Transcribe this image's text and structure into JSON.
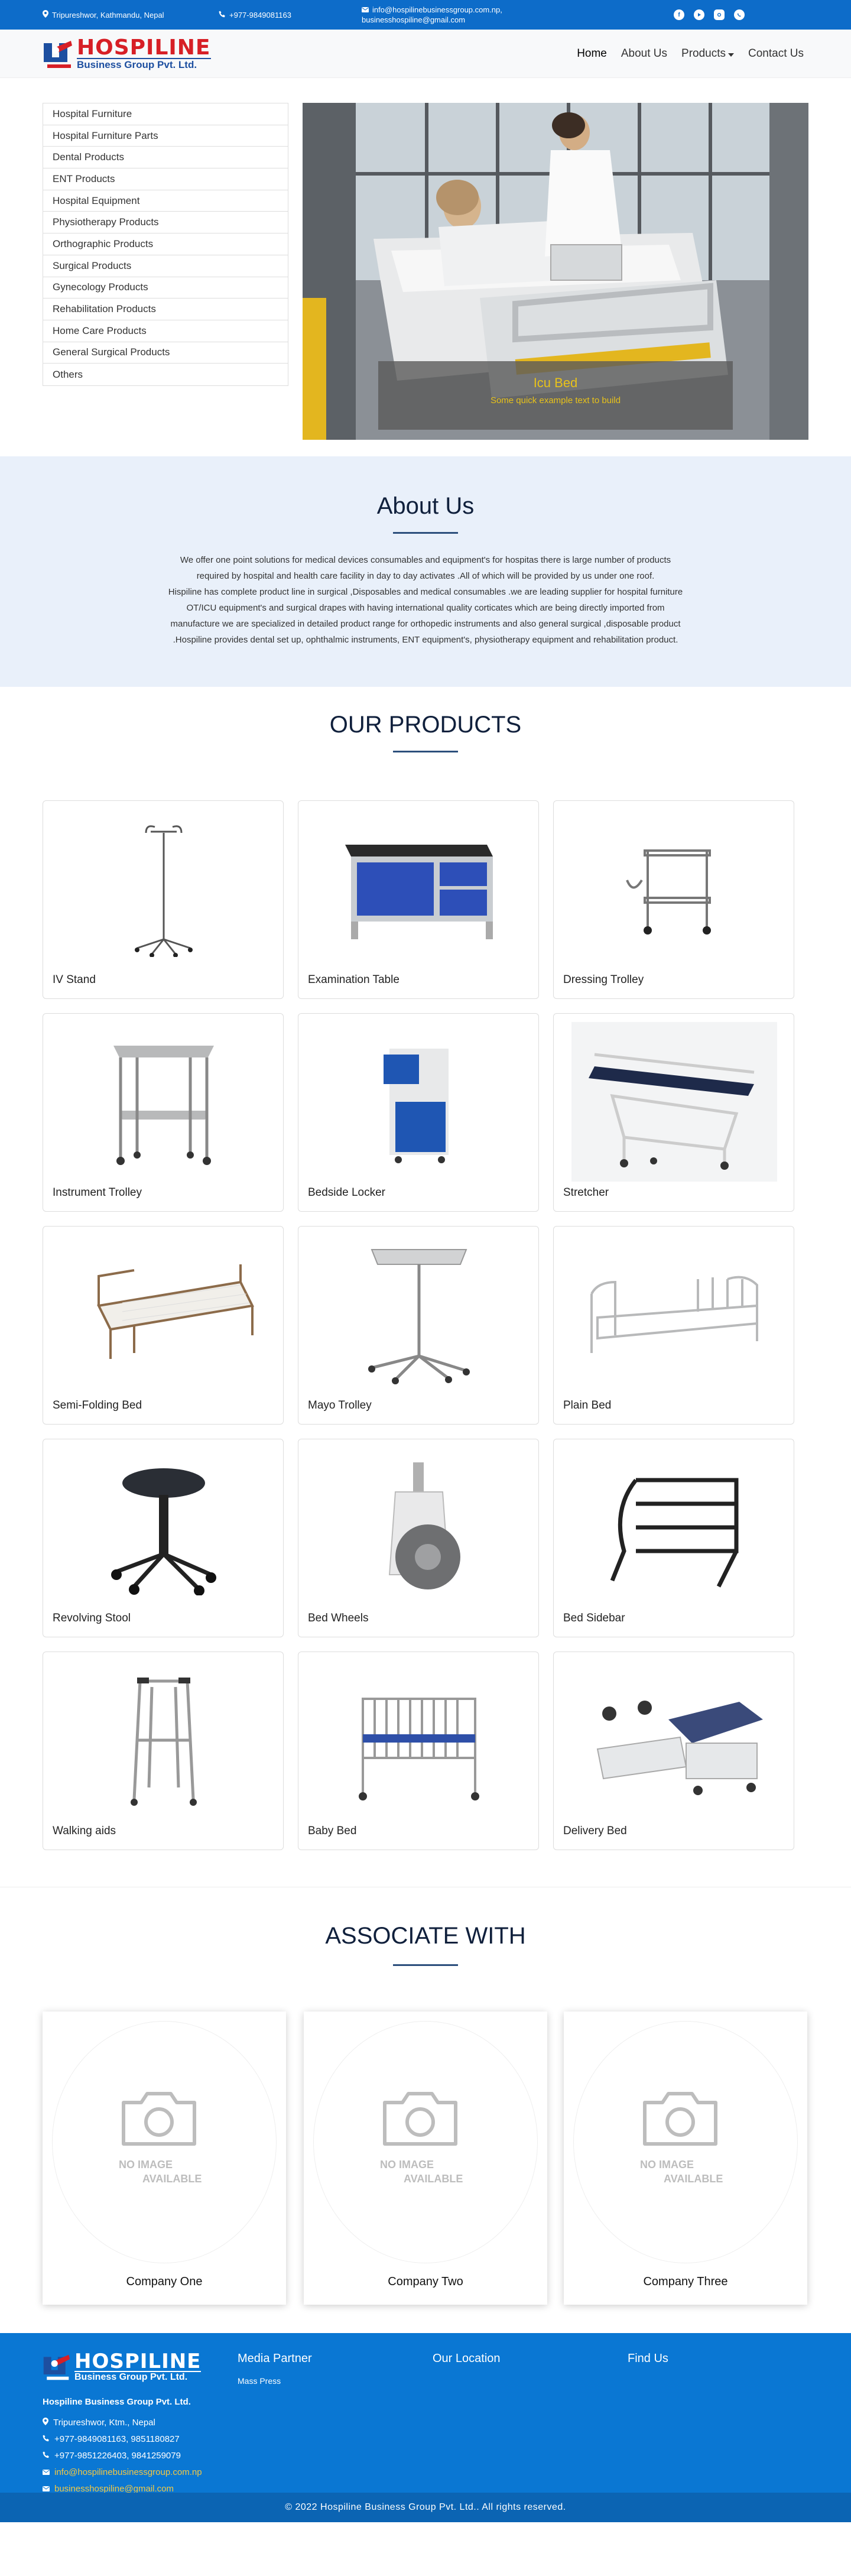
{
  "topbar": {
    "address": "Tripureshwor, Kathmandu, Nepal",
    "phone": "+977-9849081163",
    "email1": "info@hospilinebusinessgroup.com.np,",
    "email2": "businesshospiline@gmail.com"
  },
  "brand": {
    "name": "HOSPILINE",
    "sub": "Business Group Pvt. Ltd.",
    "color_red": "#d71f26",
    "color_blue": "#1d4fa0"
  },
  "nav": {
    "home": "Home",
    "about": "About Us",
    "products": "Products",
    "contact": "Contact Us"
  },
  "sidebar": {
    "items": [
      "Hospital Furniture",
      "Hospital Furniture Parts",
      "Dental Products",
      "ENT Products",
      "Hospital Equipment",
      "Physiotherapy Products",
      "Orthographic Products",
      "Surgical Products",
      "Gynecology Products",
      "Rehabilitation Products",
      "Home Care Products",
      "General Surgical Products",
      "Others"
    ]
  },
  "carousel": {
    "caption_title": "Icu Bed",
    "caption_text": "Some quick example text to build"
  },
  "about": {
    "title": "About Us",
    "lines": [
      "We offer one point solutions for medical devices consumables and equipment's for hospitas there is large number of products",
      "required by hospital and health care facility in day to day activates .All of which will be provided by us under one roof.",
      "Hispiline has complete product line in surgical ,Disposables and medical consumables .we are leading supplier for hospital furniture",
      "OT/ICU equipment's and surgical drapes with having international quality corticates which are being directly imported from",
      "manufacture we are specialized in detailed product range for orthopedic instruments and also general surgical ,disposable product",
      ".Hospiline provides dental set up, ophthalmic instruments, ENT equipment's, physiotherapy equipment and rehabilitation product."
    ]
  },
  "products": {
    "title": "OUR PRODUCTS",
    "items": [
      "IV Stand",
      "Examination Table",
      "Dressing Trolley",
      "Instrument Trolley",
      "Bedside Locker",
      "Stretcher",
      "Semi-Folding Bed",
      "Mayo Trolley",
      "Plain Bed",
      "Revolving Stool",
      "Bed Wheels",
      "Bed Sidebar",
      "Walking aids",
      "Baby Bed",
      "Delivery Bed"
    ]
  },
  "associate": {
    "title": "ASSOCIATE WITH",
    "placeholder_l1": "NO IMAGE",
    "placeholder_l2": "AVAILABLE",
    "companies": [
      "Company One",
      "Company Two",
      "Company Three"
    ]
  },
  "footer": {
    "company": "Hospiline Business Group Pvt. Ltd.",
    "address": "Tripureshwor, Ktm., Nepal",
    "phone1": "+977-9849081163, 9851180827",
    "phone2": "+977-9851226403, 9841259079",
    "email1": "info@hospilinebusinessgroup.com.np",
    "email2": "businesshospiline@gmail.com",
    "media_title": "Media Partner",
    "media_text": "Mass Press",
    "location_title": "Our Location",
    "find_title": "Find Us",
    "copyright": "© 2022 Hospiline Business Group Pvt. Ltd.. All rights reserved."
  }
}
